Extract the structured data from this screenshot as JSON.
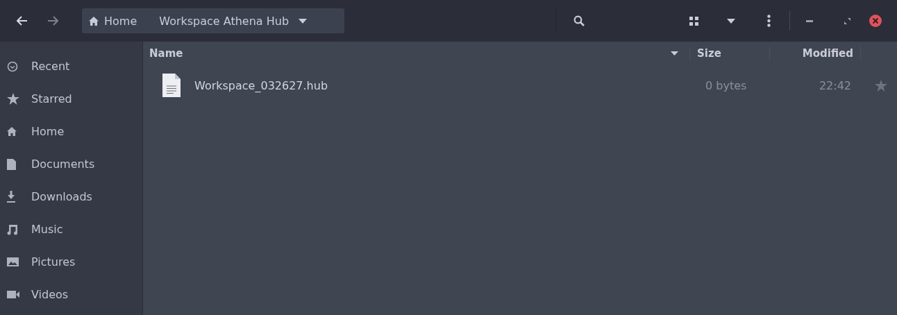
{
  "path_bar": {
    "segments": [
      {
        "label": "Home",
        "kind": "home"
      },
      {
        "label": "Workspace Athena Hub",
        "kind": "folder"
      }
    ]
  },
  "sidebar": {
    "items": [
      {
        "label": "Recent",
        "kind": "recent"
      },
      {
        "label": "Starred",
        "kind": "starred"
      },
      {
        "label": "Home",
        "kind": "home"
      },
      {
        "label": "Documents",
        "kind": "documents"
      },
      {
        "label": "Downloads",
        "kind": "downloads"
      },
      {
        "label": "Music",
        "kind": "music"
      },
      {
        "label": "Pictures",
        "kind": "pictures"
      },
      {
        "label": "Videos",
        "kind": "videos"
      }
    ]
  },
  "table": {
    "columns": [
      "Name",
      "Size",
      "Modified"
    ],
    "rows": [
      {
        "name": "Workspace_032627.hub",
        "size": "0 bytes",
        "modified": "22:42",
        "starred": false
      }
    ]
  }
}
